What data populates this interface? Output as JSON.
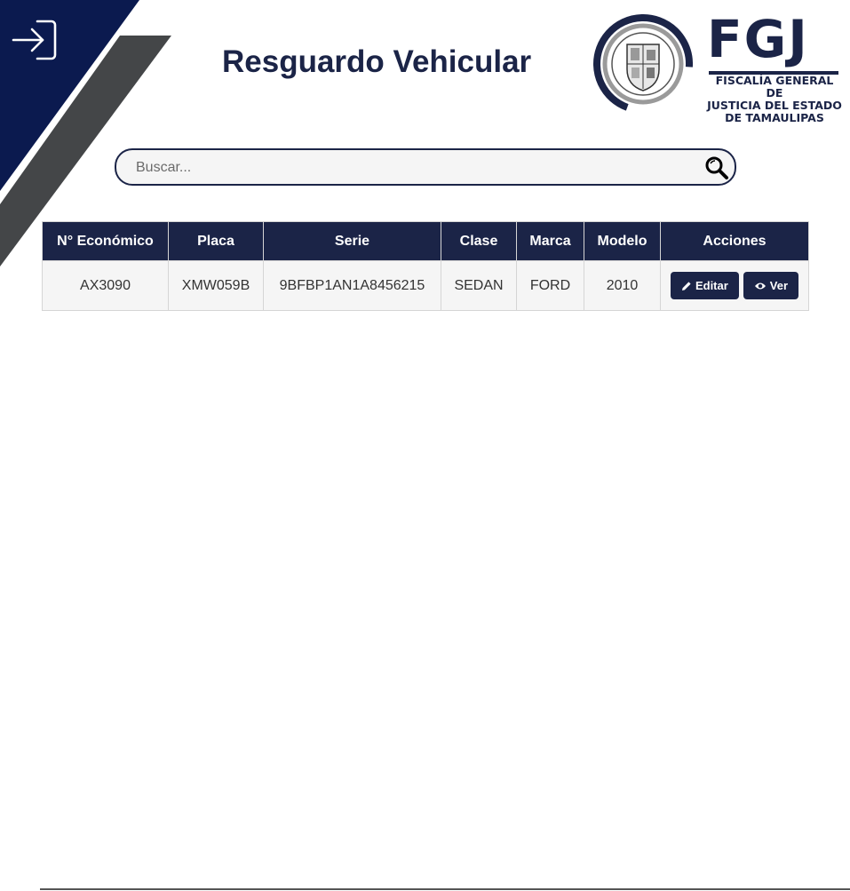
{
  "header": {
    "title": "Resguardo Vehicular",
    "login_icon": "login-icon"
  },
  "logo": {
    "acronym": "FGJ",
    "subtitle_lines": [
      "FISCALÍA GENERAL DE",
      "JUSTICIA DEL ESTADO",
      "DE TAMAULIPAS"
    ],
    "seal_icon": "state-seal-icon"
  },
  "search": {
    "placeholder": "Buscar...",
    "value": "",
    "icon": "magnifier-icon"
  },
  "table": {
    "columns": [
      "N° Económico",
      "Placa",
      "Serie",
      "Clase",
      "Marca",
      "Modelo",
      "Acciones"
    ],
    "rows": [
      {
        "numero_economico": "AX3090",
        "placa": "XMW059B",
        "serie": "9BFBP1AN1A8456215",
        "clase": "SEDAN",
        "marca": "FORD",
        "modelo": "2010",
        "actions": {
          "edit_label": "Editar",
          "view_label": "Ver"
        }
      }
    ]
  },
  "colors": {
    "primary": "#1b2447",
    "corner_gray": "#444648",
    "row_bg": "#f5f5f5"
  }
}
